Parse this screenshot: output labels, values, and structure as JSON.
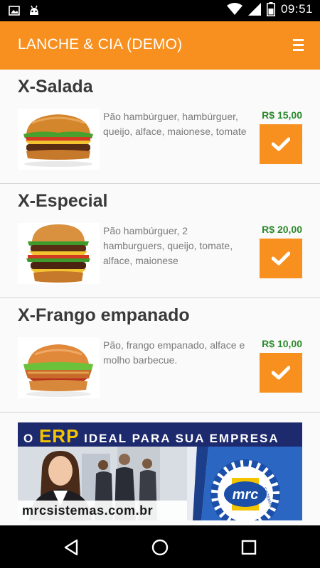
{
  "status_bar": {
    "time": "09:51",
    "left_icons": [
      "image-icon",
      "android-icon"
    ],
    "right_icons": [
      "wifi-icon",
      "signal-icon",
      "battery-icon"
    ]
  },
  "app_bar": {
    "title": "LANCHE & CIA (DEMO)",
    "menu_icon": "menu-icon"
  },
  "menu_items": [
    {
      "name": "X-Salada",
      "description": "Pão hambúrguer, hambúrguer, queijo, alface, maionese, tomate",
      "price": "R$ 15,00"
    },
    {
      "name": "X-Especial",
      "description": "Pão hambúrguer, 2 hamburguers, queijo, tomate, alface, maionese",
      "price": "R$ 20,00"
    },
    {
      "name": "X-Frango empanado",
      "description": "Pão, frango empanado, alface e molho barbecue.",
      "price": "R$ 10,00"
    }
  ],
  "banner": {
    "headline_prefix": "O",
    "headline_erp": "ERP",
    "headline_suffix": "IDEAL PARA SUA EMPRESA",
    "url": "mrcsistemas.com.br",
    "logo_text": "mrc",
    "logo_ring_text": "SISTEMAS"
  },
  "colors": {
    "accent": "#f7901e",
    "price": "#2a8a2a",
    "text_title": "#3a3a3a",
    "text_desc": "#7a7a7a"
  },
  "nav_bar": {
    "buttons": [
      "back-icon",
      "home-icon",
      "recents-icon"
    ]
  }
}
